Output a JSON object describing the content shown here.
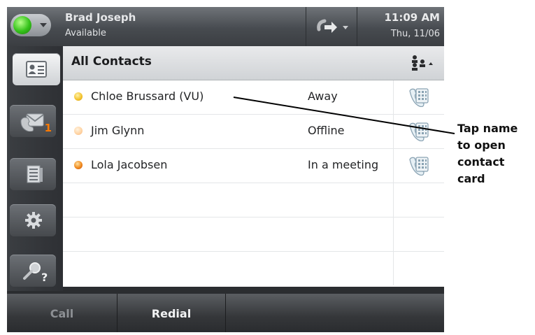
{
  "header": {
    "user_name": "Brad Joseph",
    "user_status": "Available",
    "time": "11:09 AM",
    "date": "Thu, 11/06",
    "presence_color": "#34c21a"
  },
  "sidebar": {
    "items": [
      {
        "icon": "contact-card-icon",
        "active": true
      },
      {
        "icon": "voicemail-icon",
        "badge": "1"
      },
      {
        "icon": "call-log-icon"
      },
      {
        "icon": "gear-icon"
      },
      {
        "icon": "search-help-icon"
      }
    ]
  },
  "list": {
    "title": "All Contacts",
    "rows": [
      {
        "name": "Chloe Brussard (VU)",
        "status": "Away",
        "presence_color": "#f2c12a"
      },
      {
        "name": "Jim Glynn",
        "status": "Offline",
        "presence_color": "#ffd2a0"
      },
      {
        "name": "Lola Jacobsen",
        "status": "In a meeting",
        "presence_color": "#f08a1e"
      }
    ]
  },
  "softkeys": {
    "call": "Call",
    "redial": "Redial"
  },
  "annotation": {
    "callout": "Tap name to open contact card"
  }
}
